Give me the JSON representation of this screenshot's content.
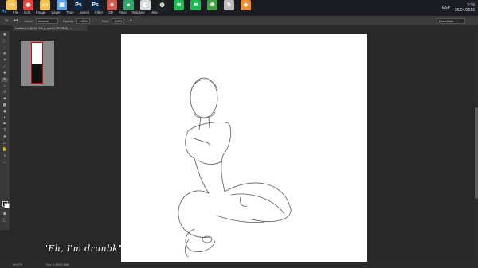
{
  "taskbar": {
    "apps": [
      {
        "name": "file-explorer-icon",
        "color": "#f2c14e",
        "glyph": "▭"
      },
      {
        "name": "chrome-icon",
        "color": "#e7453c",
        "glyph": "◉"
      },
      {
        "name": "folder-icon",
        "color": "#f2c14e",
        "glyph": "▭"
      },
      {
        "name": "monitor-icon",
        "color": "#5aa3e8",
        "glyph": "▣"
      },
      {
        "name": "photoshop-icon",
        "color": "#0b2a4a",
        "glyph": "Ps"
      },
      {
        "name": "photoshop-alt-icon",
        "color": "#0b2a4a",
        "glyph": "Ps"
      },
      {
        "name": "person-icon",
        "color": "#d35a4a",
        "glyph": "☻"
      },
      {
        "name": "app-icon",
        "color": "#2fa86a",
        "glyph": "●"
      },
      {
        "name": "media-icon",
        "color": "#d9d9d9",
        "glyph": "◧"
      },
      {
        "name": "obs-icon",
        "color": "#222",
        "glyph": "◍"
      },
      {
        "name": "spotify-icon",
        "color": "#1db954",
        "glyph": "≋"
      },
      {
        "name": "spotify-alt-icon",
        "color": "#1db954",
        "glyph": "≋"
      },
      {
        "name": "clover-icon",
        "color": "#3fa344",
        "glyph": "✤"
      },
      {
        "name": "pen-icon",
        "color": "#bbbbbb",
        "glyph": "✎"
      },
      {
        "name": "paint-icon",
        "color": "#f48c2f",
        "glyph": "◆"
      }
    ],
    "tray": {
      "language": "ESP",
      "time": "2:36",
      "date": "26/04/2016"
    }
  },
  "menubar": {
    "logo": "Ps",
    "items": [
      "File",
      "Edit",
      "Image",
      "Layer",
      "Type",
      "Select",
      "Filter",
      "3D",
      "View",
      "Window",
      "Help"
    ]
  },
  "options": {
    "mode_label": "Mode:",
    "mode_value": "Normal",
    "opacity_label": "Opacity:",
    "opacity_value": "100%",
    "flow_label": "Flow:",
    "flow_value": "100%",
    "workspace": "Essentials"
  },
  "document": {
    "tab_title": "Untitled-1 @ 66.7% (Layer 2, RGB/8)"
  },
  "status": {
    "zoom": "66.67%",
    "doc_size": "Doc: 2.49M/2.88M"
  },
  "caption": {
    "text": "\"Eh, I'm drunbk\""
  },
  "colors": {
    "accent": "#31a8ff",
    "foreground": "#000000",
    "background": "#ffffff"
  }
}
